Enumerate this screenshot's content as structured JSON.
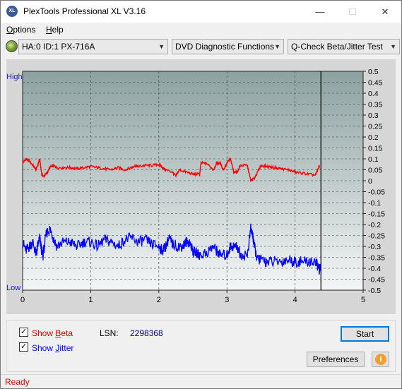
{
  "window": {
    "title": "PlexTools Professional XL V3.16",
    "icon_text": "XL",
    "minimize_glyph": "—",
    "maximize_glyph": "☐",
    "close_glyph": "✕"
  },
  "menu": [
    {
      "label": "Options",
      "underline": "O",
      "rest": "ptions"
    },
    {
      "label": "Help",
      "underline": "H",
      "rest": "elp"
    }
  ],
  "toolbar": {
    "drive": "HA:0 ID:1  PX-716A",
    "function": "DVD Diagnostic Functions",
    "test": "Q-Check Beta/Jitter Test",
    "drive_icon": "disc-icon"
  },
  "chart_data": {
    "type": "line",
    "x_ticks": [
      "0",
      "1",
      "2",
      "3",
      "4",
      "5"
    ],
    "xlim": [
      0,
      5
    ],
    "y_right_ticks": [
      "0.5",
      "0.45",
      "0.4",
      "0.35",
      "0.3",
      "0.25",
      "0.2",
      "0.15",
      "0.1",
      "0.05",
      "0",
      "-0.05",
      "-0.1",
      "-0.15",
      "-0.2",
      "-0.25",
      "-0.3",
      "-0.35",
      "-0.4",
      "-0.45",
      "-0.5"
    ],
    "ylim": [
      -0.5,
      0.5
    ],
    "y_left_top": "High",
    "y_left_bottom": "Low",
    "grid": true,
    "end_marker_x": 4.38,
    "series": [
      {
        "name": "Beta",
        "color": "#ff0000",
        "x": [
          0.0,
          0.05,
          0.1,
          0.15,
          0.2,
          0.25,
          0.28,
          0.3,
          0.35,
          0.4,
          0.45,
          0.5,
          0.6,
          0.7,
          0.8,
          0.9,
          1.0,
          1.1,
          1.2,
          1.3,
          1.4,
          1.5,
          1.6,
          1.65,
          1.7,
          1.8,
          1.9,
          2.0,
          2.05,
          2.1,
          2.2,
          2.25,
          2.3,
          2.4,
          2.5,
          2.6,
          2.62,
          2.7,
          2.8,
          2.85,
          2.9,
          2.95,
          3.0,
          3.05,
          3.1,
          3.15,
          3.2,
          3.3,
          3.35,
          3.4,
          3.45,
          3.5,
          3.6,
          3.7,
          3.8,
          3.9,
          4.0,
          4.1,
          4.2,
          4.3,
          4.36
        ],
        "y": [
          0.08,
          0.1,
          0.09,
          0.07,
          0.05,
          0.1,
          0.03,
          0.02,
          0.03,
          0.06,
          0.07,
          0.06,
          0.06,
          0.06,
          0.055,
          0.06,
          0.065,
          0.06,
          0.055,
          0.05,
          0.06,
          0.05,
          0.06,
          0.07,
          0.065,
          0.07,
          0.07,
          0.075,
          0.06,
          0.05,
          0.04,
          0.02,
          0.05,
          0.04,
          0.03,
          0.03,
          0.08,
          0.08,
          0.05,
          0.08,
          0.08,
          0.05,
          0.08,
          0.1,
          0.04,
          0.04,
          0.07,
          0.07,
          0.0,
          0.01,
          0.04,
          0.07,
          0.065,
          0.06,
          0.055,
          0.05,
          0.04,
          0.035,
          0.03,
          0.025,
          0.07
        ]
      },
      {
        "name": "Jitter",
        "color": "#0000ff",
        "x": [
          0.0,
          0.05,
          0.1,
          0.15,
          0.2,
          0.22,
          0.25,
          0.28,
          0.3,
          0.35,
          0.4,
          0.45,
          0.5,
          0.6,
          0.7,
          0.8,
          0.9,
          1.0,
          1.1,
          1.2,
          1.3,
          1.4,
          1.5,
          1.6,
          1.7,
          1.8,
          1.9,
          2.0,
          2.05,
          2.1,
          2.15,
          2.2,
          2.3,
          2.35,
          2.4,
          2.45,
          2.5,
          2.55,
          2.6,
          2.7,
          2.8,
          2.85,
          2.9,
          3.0,
          3.05,
          3.1,
          3.15,
          3.2,
          3.3,
          3.35,
          3.38,
          3.4,
          3.45,
          3.5,
          3.6,
          3.7,
          3.8,
          3.9,
          4.0,
          4.1,
          4.2,
          4.3,
          4.35,
          4.38
        ],
        "y": [
          -0.28,
          -0.32,
          -0.3,
          -0.28,
          -0.34,
          -0.3,
          -0.26,
          -0.32,
          -0.34,
          -0.24,
          -0.22,
          -0.26,
          -0.3,
          -0.28,
          -0.28,
          -0.3,
          -0.28,
          -0.28,
          -0.3,
          -0.27,
          -0.28,
          -0.3,
          -0.27,
          -0.26,
          -0.28,
          -0.27,
          -0.29,
          -0.3,
          -0.32,
          -0.3,
          -0.26,
          -0.29,
          -0.3,
          -0.3,
          -0.28,
          -0.28,
          -0.32,
          -0.33,
          -0.34,
          -0.33,
          -0.3,
          -0.32,
          -0.34,
          -0.34,
          -0.3,
          -0.3,
          -0.3,
          -0.34,
          -0.34,
          -0.22,
          -0.25,
          -0.3,
          -0.36,
          -0.36,
          -0.37,
          -0.37,
          -0.37,
          -0.36,
          -0.37,
          -0.37,
          -0.37,
          -0.37,
          -0.4,
          -0.41
        ]
      }
    ]
  },
  "bottom": {
    "show_beta_label": "Show Beta",
    "show_beta_u": "B",
    "show_jitter_label": "Show Jitter",
    "show_jitter_u": "J",
    "lsn_label": "LSN:",
    "lsn_value": "2298368",
    "start_label": "Start",
    "preferences_label": "Preferences",
    "info_icon": "info-icon",
    "beta_color": "#d40000",
    "jitter_color": "#0000ff"
  },
  "status": {
    "text": "Ready"
  }
}
